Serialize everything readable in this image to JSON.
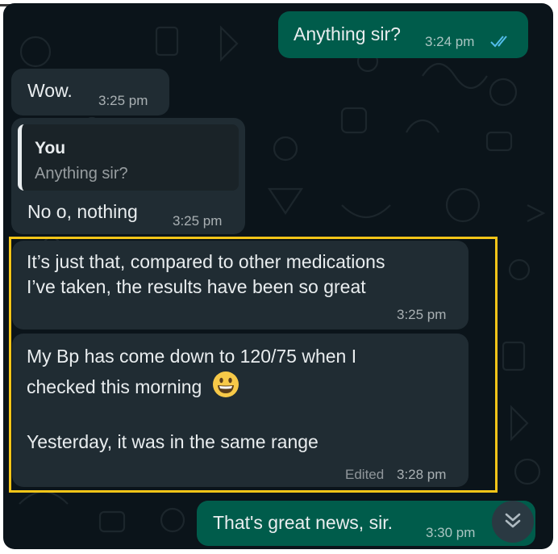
{
  "messages": [
    {
      "text": "Anything sir?",
      "time": "3:24 pm",
      "direction": "outgoing",
      "status": "read"
    },
    {
      "text": "Wow.",
      "time": "3:25 pm",
      "direction": "incoming"
    },
    {
      "quote_author": "You",
      "quote_text": "Anything sir?",
      "text": "No o, nothing",
      "time": "3:25 pm",
      "direction": "incoming"
    },
    {
      "line1": "It’s just that, compared to other medications",
      "line2": "I’ve taken, the results have been so great",
      "time": "3:25 pm",
      "direction": "incoming"
    },
    {
      "line1": "My Bp has come down to 120/75 when I",
      "line2": "checked this morning",
      "emoji": "grinning-face-icon",
      "line3": "Yesterday, it was in the same range",
      "edited": "Edited",
      "time": "3:28 pm",
      "direction": "incoming"
    },
    {
      "text": "That's great news, sir.",
      "time": "3:30 pm",
      "direction": "outgoing"
    }
  ],
  "colors": {
    "background": "#0b141a",
    "incoming_bubble": "#202c33",
    "outgoing_bubble": "#005c4b",
    "read_ticks": "#53bdeb",
    "highlight": "#f5c518"
  },
  "controls": {
    "scroll_down": "double-chevron-down-icon"
  }
}
